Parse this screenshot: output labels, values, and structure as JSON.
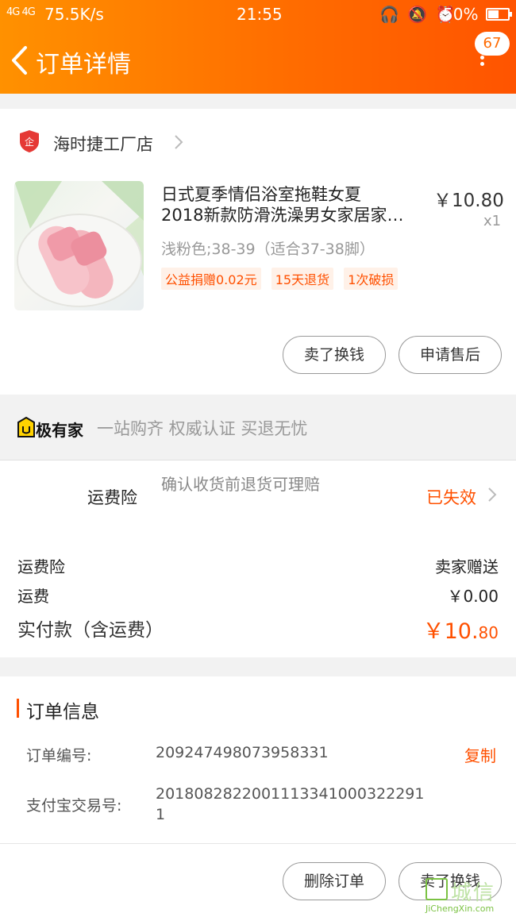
{
  "status_bar": {
    "signal": "4G 4G",
    "speed": "75.5K/s",
    "time": "21:55",
    "icons": "🎧 🔕 ⏰",
    "battery": "50%"
  },
  "header": {
    "title": "订单详情",
    "notification_count": "67"
  },
  "shop": {
    "name": "海时捷工厂店",
    "icon_text": "企"
  },
  "product": {
    "title_line1": "日式夏季情侣浴室拖鞋女夏",
    "title_line2": "2018新款防滑洗澡男女家居家…",
    "price": "￥10.80",
    "quantity": "x1",
    "sku": "浅粉色;38-39（适合37-38脚）",
    "tags": [
      "公益捐赠0.02元",
      "15天退货",
      "1次破损"
    ]
  },
  "item_actions": {
    "sell_label": "卖了换钱",
    "after_sale_label": "申请售后"
  },
  "banner": {
    "brand": "极有家",
    "slogan": "一站购齐 权威认证 买退无忧"
  },
  "insurance": {
    "label": "运费险",
    "description": "确认收货前退货可理赔",
    "status": "已失效"
  },
  "costs": {
    "insurance_label": "运费险",
    "insurance_value": "卖家赠送",
    "shipping_label": "运费",
    "shipping_value": "￥0.00",
    "total_label": "实付款（含运费）",
    "total_main": "￥10.",
    "total_cents": "80"
  },
  "order_info": {
    "title": "订单信息",
    "order_no_label": "订单编号:",
    "order_no_value": "209247498073958331",
    "copy_label": "复制",
    "alipay_label": "支付宝交易号:",
    "alipay_value_line1": "2018082822001113341000322291",
    "alipay_value_line2": "1"
  },
  "bottom_actions": {
    "delete_label": "删除订单",
    "sell_label": "卖了换钱"
  },
  "watermark": {
    "text": "城信",
    "sub": "JiChengXin.com"
  },
  "colors": {
    "accent": "#ff5000",
    "header_start": "#ff9100",
    "header_end": "#ff5400"
  }
}
